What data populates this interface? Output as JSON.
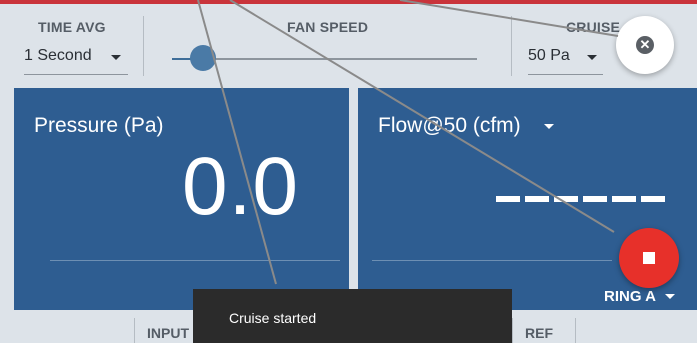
{
  "controls": {
    "time_avg": {
      "label": "TIME AVG",
      "value": "1 Second"
    },
    "fan_speed": {
      "label": "FAN SPEED",
      "value_fraction": 0.1
    },
    "cruise": {
      "label": "CRUISE",
      "value": "50 Pa"
    }
  },
  "panels": {
    "pressure": {
      "title": "Pressure (Pa)",
      "value": "0.0"
    },
    "flow": {
      "title": "Flow@50 (cfm)",
      "value": "------",
      "ring": "RING A"
    }
  },
  "tabs": {
    "input": "INPUT",
    "ref": "REF"
  },
  "toast": {
    "message": "Cruise started"
  },
  "colors": {
    "accent_red": "#c9343b",
    "panel_blue": "#2e5d91",
    "stop_red": "#e7302a"
  },
  "icons": {
    "close": "close-circle-icon",
    "stop": "stop-icon"
  }
}
